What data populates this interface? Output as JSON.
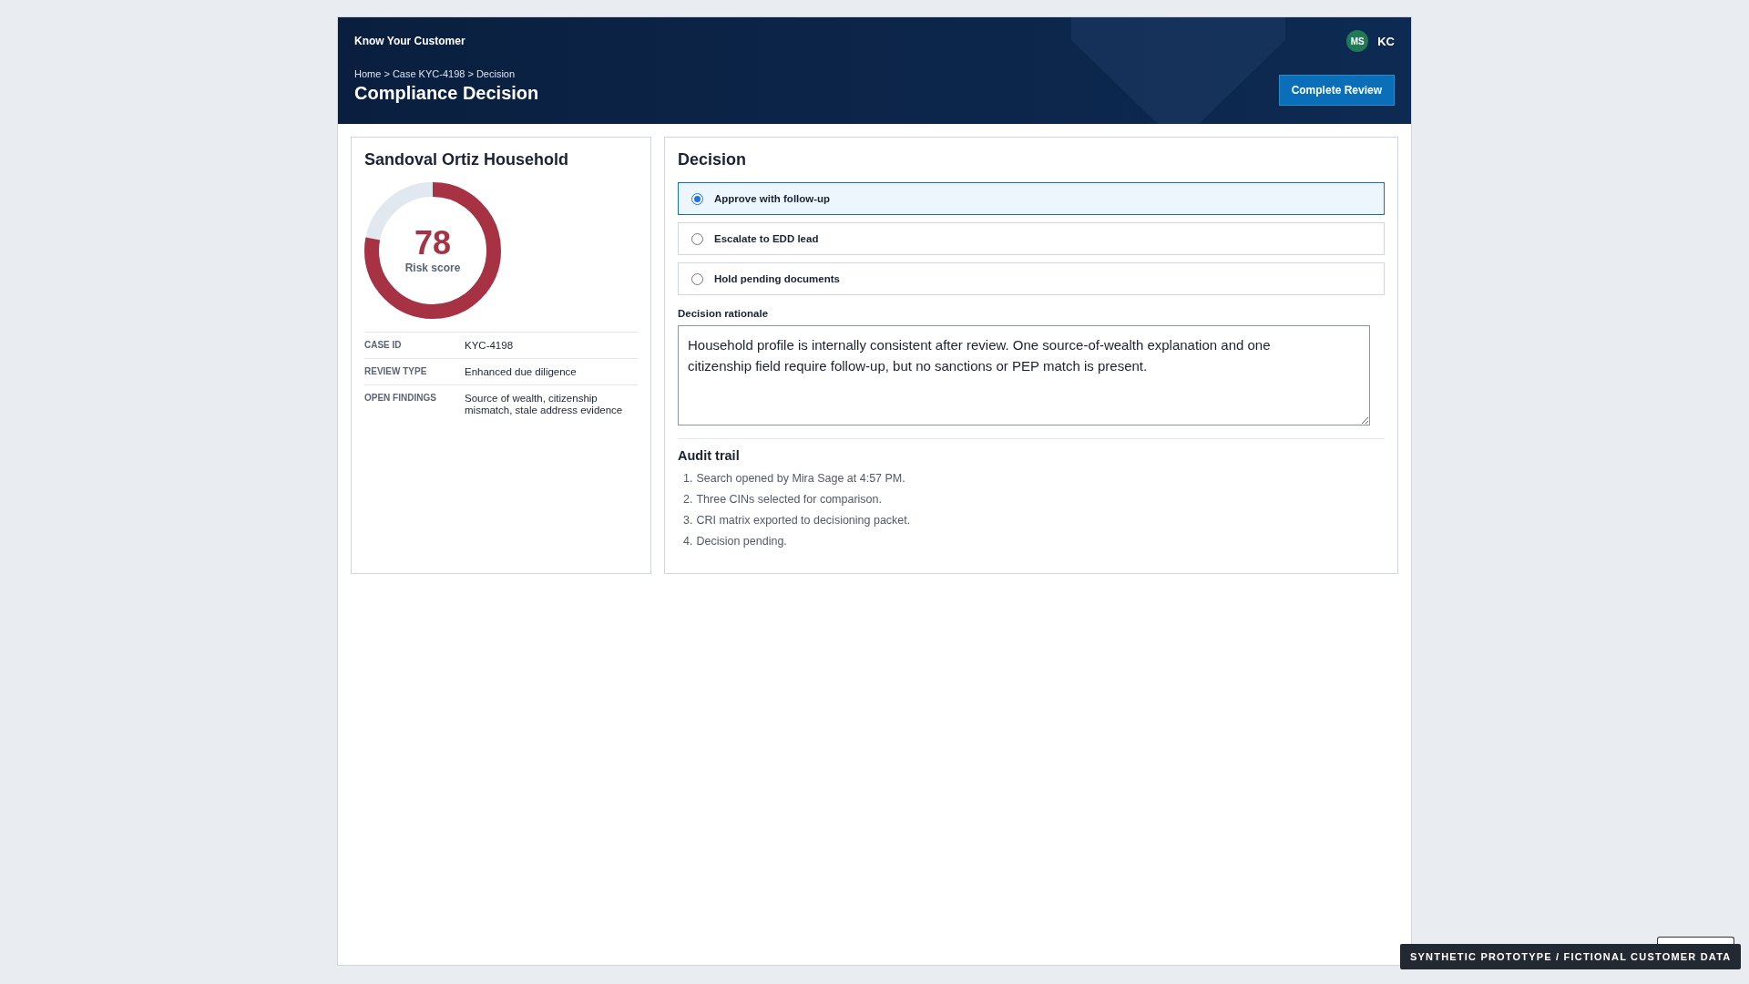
{
  "header": {
    "app_title": "Know Your Customer",
    "avatar": "MS",
    "user": "KC",
    "breadcrumb": "Home > Case KYC-4198 > Decision",
    "title": "Compliance Decision",
    "primary_button": "Complete Review"
  },
  "profile": {
    "name": "Sandoval Ortiz Household",
    "score": {
      "value": "78",
      "label": "Risk score",
      "level": 0.78
    },
    "facts": [
      {
        "label": "CASE ID",
        "value": "KYC-4198"
      },
      {
        "label": "REVIEW TYPE",
        "value": "Enhanced due diligence"
      },
      {
        "label": "OPEN FINDINGS",
        "value": "Source of wealth, citizenship mismatch, stale address evidence"
      }
    ]
  },
  "decision": {
    "title": "Decision",
    "options": [
      {
        "label": "Approve with follow-up",
        "selected": true
      },
      {
        "label": "Escalate to EDD lead",
        "selected": false
      },
      {
        "label": "Hold pending documents",
        "selected": false
      }
    ],
    "rationale_label": "Decision rationale",
    "rationale": "Household profile is internally consistent after review. One source-of-wealth explanation and one citizenship field require follow-up, but no sanctions or PEP match is present.",
    "audit_title": "Audit trail",
    "audit": [
      {
        "marker": "1.",
        "text": "Search opened by Mira Sage at 4:57 PM."
      },
      {
        "marker": "2.",
        "text": "Three CINs selected for comparison."
      },
      {
        "marker": "3.",
        "text": "CRI matrix exported to decisioning packet."
      },
      {
        "marker": "4.",
        "text": "Decision pending."
      }
    ]
  },
  "footer": {
    "banner": "SYNTHETIC PROTOTYPE / FICTIONAL CUSTOMER DATA"
  }
}
